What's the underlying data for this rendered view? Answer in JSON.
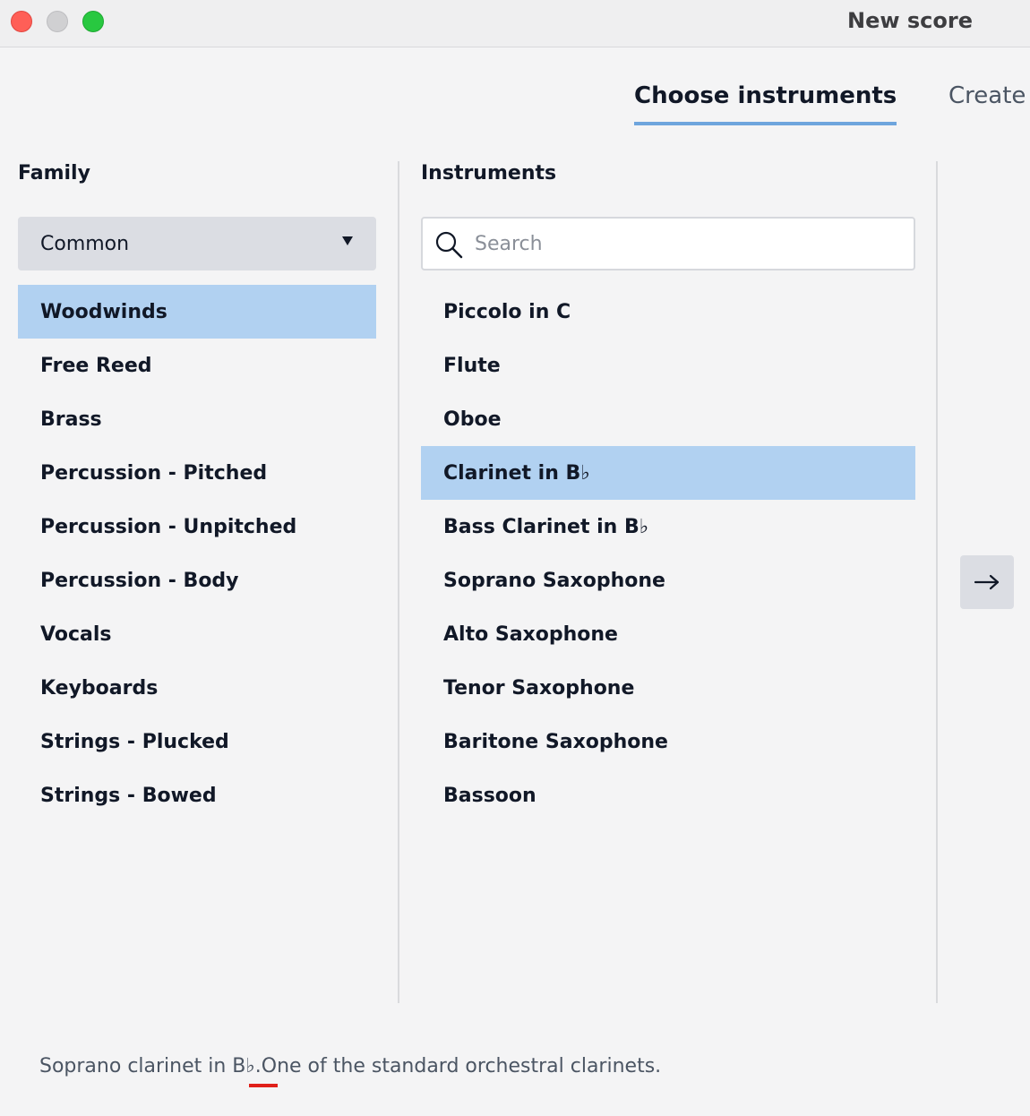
{
  "window": {
    "title": "New score"
  },
  "tabs": [
    {
      "label": "Choose instruments",
      "active": true
    },
    {
      "label": "Create",
      "active": false
    }
  ],
  "family": {
    "heading": "Family",
    "dropdown_value": "Common",
    "items": [
      {
        "label": "Woodwinds",
        "selected": true
      },
      {
        "label": "Free Reed"
      },
      {
        "label": "Brass"
      },
      {
        "label": "Percussion - Pitched"
      },
      {
        "label": "Percussion - Unpitched"
      },
      {
        "label": "Percussion - Body"
      },
      {
        "label": "Vocals"
      },
      {
        "label": "Keyboards"
      },
      {
        "label": "Strings - Plucked"
      },
      {
        "label": "Strings - Bowed"
      }
    ]
  },
  "instruments": {
    "heading": "Instruments",
    "search_placeholder": "Search",
    "search_value": "",
    "items": [
      {
        "label": "Piccolo in C"
      },
      {
        "label": "Flute"
      },
      {
        "label": "Oboe"
      },
      {
        "label": "Clarinet in B♭",
        "selected": true
      },
      {
        "label": "Bass Clarinet in B♭"
      },
      {
        "label": "Soprano Saxophone"
      },
      {
        "label": "Alto Saxophone"
      },
      {
        "label": "Tenor Saxophone"
      },
      {
        "label": "Baritone Saxophone"
      },
      {
        "label": "Bassoon"
      }
    ]
  },
  "description": "Soprano clarinet in B♭.One of the standard orchestral clarinets.",
  "icons": {
    "search": "search-icon",
    "add": "arrow-right-icon",
    "dropdown": "triangle-down-icon"
  },
  "colors": {
    "selection": "#b1d1f1",
    "tab_underline": "#6ea5dd",
    "close": "#ff5f57",
    "maximize": "#28c840",
    "spellcheck": "#e0201a"
  }
}
